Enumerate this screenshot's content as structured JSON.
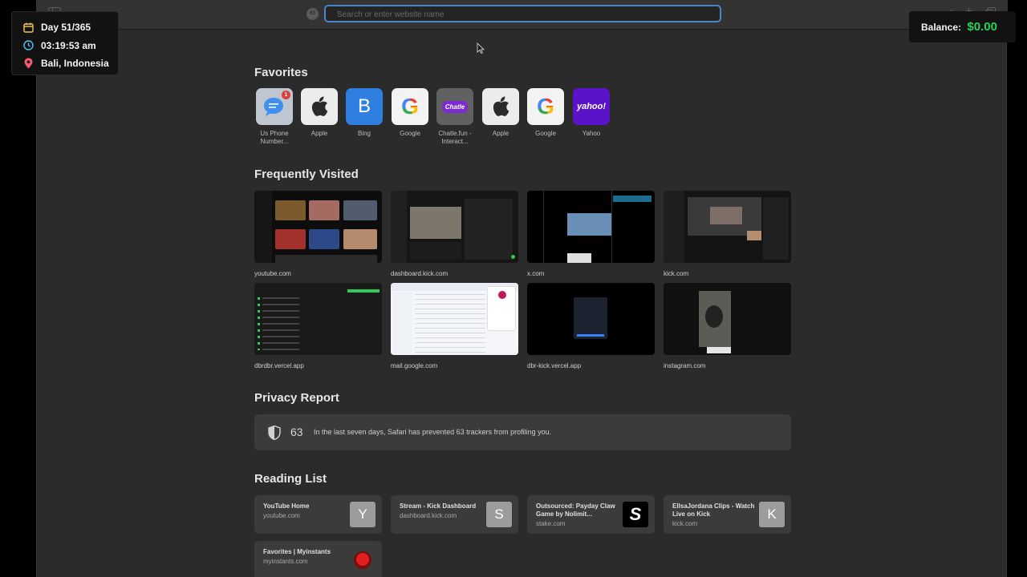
{
  "hud": {
    "day": "Day 51/365",
    "time": "03:19:53 am",
    "location": "Bali, Indonesia",
    "balance_label": "Balance:",
    "balance_value": "$0.00"
  },
  "toolbar": {
    "address_placeholder": "Search or enter website name"
  },
  "favorites": {
    "title": "Favorites",
    "items": [
      {
        "label": "Us Phone Number...",
        "icon": "messages-icon",
        "badge": "1"
      },
      {
        "label": "Apple",
        "icon": "apple-icon"
      },
      {
        "label": "Bing",
        "icon": "bing-icon",
        "glyph": "B"
      },
      {
        "label": "Google",
        "icon": "google-icon",
        "glyph": "G"
      },
      {
        "label": "Chatle.fun - Interact...",
        "icon": "chatle-icon",
        "glyph": "Chatle"
      },
      {
        "label": "Apple",
        "icon": "apple-icon"
      },
      {
        "label": "Google",
        "icon": "google-icon",
        "glyph": "G"
      },
      {
        "label": "Yahoo",
        "icon": "yahoo-icon",
        "glyph": "yahoo!"
      }
    ]
  },
  "frequently_visited": {
    "title": "Frequently Visited",
    "items": [
      {
        "label": "youtube.com"
      },
      {
        "label": "dashboard.kick.com"
      },
      {
        "label": "x.com"
      },
      {
        "label": "kick.com"
      },
      {
        "label": "dbrdbr.vercel.app"
      },
      {
        "label": "mail.google.com"
      },
      {
        "label": "dbr-kick.vercel.app"
      },
      {
        "label": "instagram.com"
      }
    ]
  },
  "privacy_report": {
    "title": "Privacy Report",
    "count": "63",
    "text": "In the last seven days, Safari has prevented 63 trackers from profiling you."
  },
  "reading_list": {
    "title": "Reading List",
    "items": [
      {
        "title": "YouTube Home",
        "domain": "youtube.com",
        "letter": "Y"
      },
      {
        "title": "Stream - Kick Dashboard",
        "domain": "dashboard.kick.com",
        "letter": "S"
      },
      {
        "title": "Outsourced: Payday Claw Game by Nolimit...",
        "domain": "stake.com",
        "letter": "S"
      },
      {
        "title": "EllsaJordana Clips - Watch Live on Kick",
        "domain": "kick.com",
        "letter": "K"
      },
      {
        "title": "Favorites | Myinstants",
        "domain": "myinstants.com",
        "letter": ""
      }
    ]
  },
  "colors": {
    "accent": "#4a86c8",
    "balance": "#27d35a"
  }
}
